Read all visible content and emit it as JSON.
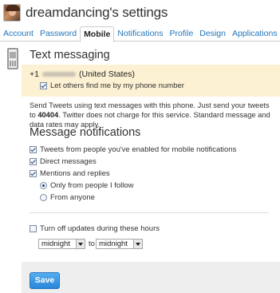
{
  "header": {
    "title": "dreamdancing's settings",
    "avatar_icon": "user-avatar"
  },
  "tabs": [
    {
      "label": "Account",
      "active": false
    },
    {
      "label": "Password",
      "active": false
    },
    {
      "label": "Mobile",
      "active": true
    },
    {
      "label": "Notifications",
      "active": false
    },
    {
      "label": "Profile",
      "active": false
    },
    {
      "label": "Design",
      "active": false
    },
    {
      "label": "Applications",
      "active": false
    }
  ],
  "text_messaging": {
    "title": "Text messaging",
    "phone_prefix": "+1",
    "phone_country": "(United States)",
    "find_by_phone": {
      "label": "Let others find me by my phone number",
      "checked": true
    },
    "description_pre": "Send Tweets using text messages with this phone. Just send your tweets to ",
    "short_code": "40404",
    "description_post": ". Twitter does not charge for this service. Standard message and data rates may apply."
  },
  "message_notifications": {
    "title": "Message notifications",
    "options": [
      {
        "label": "Tweets from people you've enabled for mobile notifications",
        "checked": true
      },
      {
        "label": "Direct messages",
        "checked": true
      },
      {
        "label": "Mentions and replies",
        "checked": true
      }
    ],
    "mentions_scope": [
      {
        "label": "Only from people I follow",
        "selected": true
      },
      {
        "label": "From anyone",
        "selected": false
      }
    ]
  },
  "quiet_hours": {
    "label": "Turn off updates during these hours",
    "checked": false,
    "from": "midnight",
    "to_label": "to",
    "to": "midnight"
  },
  "save_label": "Save",
  "colors": {
    "link": "#2276bb",
    "highlight": "#fdf1d3",
    "save_button": "#2a87d8"
  }
}
